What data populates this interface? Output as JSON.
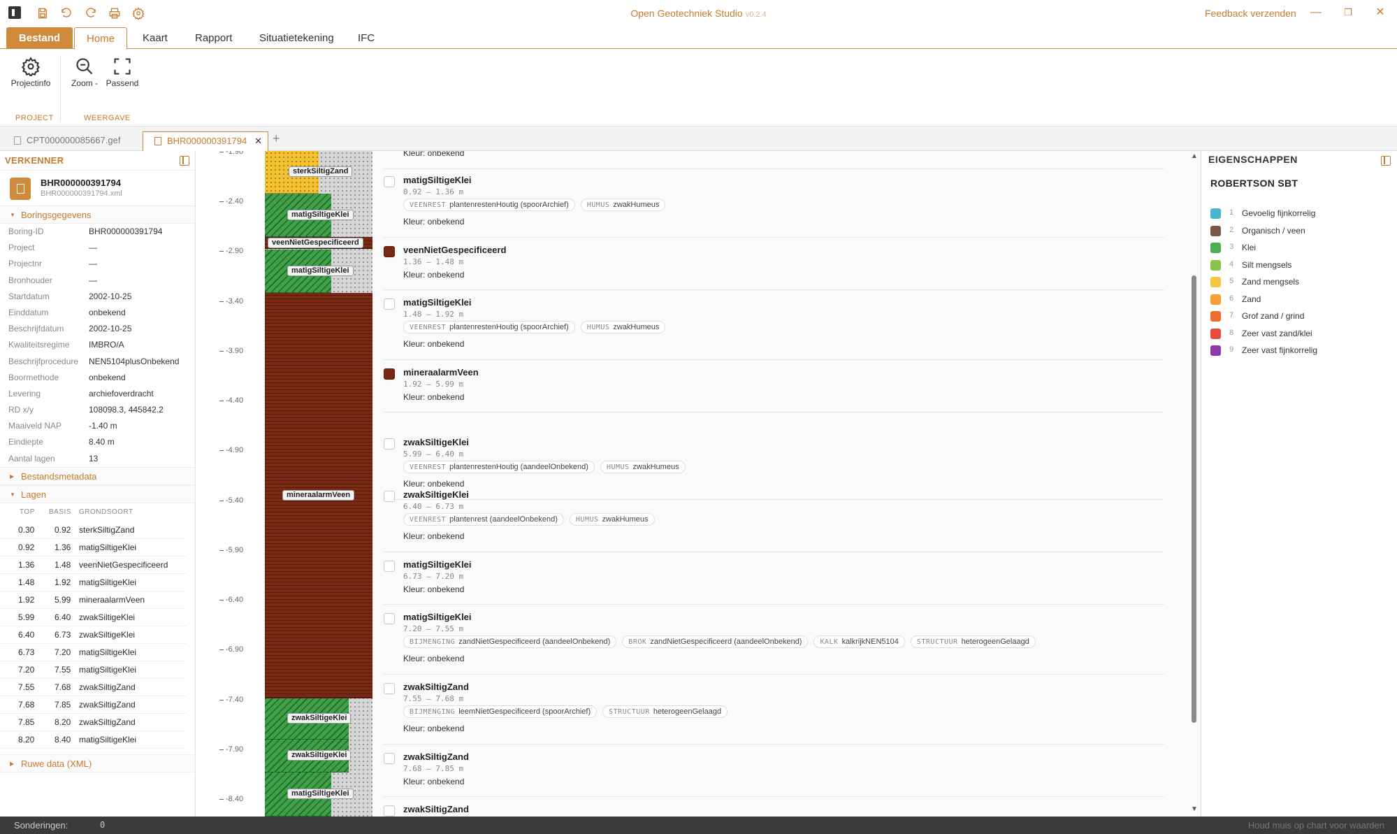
{
  "app": {
    "title": "Open Geotechniek Studio",
    "version": "v0.2.4",
    "feedback": "Feedback verzenden"
  },
  "icons": {
    "quick_access": [
      "save-icon",
      "undo-icon",
      "redo-icon",
      "print-icon",
      "settings-icon"
    ]
  },
  "ribbon": {
    "tabs": [
      "Bestand",
      "Home",
      "Kaart",
      "Rapport",
      "Situatietekening",
      "IFC"
    ],
    "active_tab": "Home",
    "buttons": {
      "projectinfo": "Projectinfo",
      "zoom": "Zoom -",
      "passend": "Passend"
    },
    "groups": {
      "project": "PROJECT",
      "weergave": "WEERGAVE"
    }
  },
  "doc_tabs": [
    {
      "label": "CPT000000085667.gef"
    },
    {
      "label": "BHR000000391794",
      "active": true
    }
  ],
  "explorer": {
    "title": "VERKENNER",
    "file": {
      "name": "BHR000000391794",
      "file": "BHR000000391794.xml"
    },
    "sections": {
      "boring": "Boringsgegevens",
      "meta": "Bestandsmetadata",
      "layers": "Lagen",
      "raw": "Ruwe data (XML)"
    },
    "props": [
      {
        "k": "Boring-ID",
        "v": "BHR000000391794"
      },
      {
        "k": "Project",
        "v": "—"
      },
      {
        "k": "Projectnr",
        "v": "—"
      },
      {
        "k": "Bronhouder",
        "v": "—"
      },
      {
        "k": "Startdatum",
        "v": "2002-10-25"
      },
      {
        "k": "Einddatum",
        "v": "onbekend"
      },
      {
        "k": "Beschrijfdatum",
        "v": "2002-10-25"
      },
      {
        "k": "Kwaliteitsregime",
        "v": "IMBRO/A"
      },
      {
        "k": "Beschrijfprocedure",
        "v": "NEN5104plusOnbekend"
      },
      {
        "k": "Boormethode",
        "v": "onbekend"
      },
      {
        "k": "Levering",
        "v": "archiefoverdracht"
      },
      {
        "k": "RD x/y",
        "v": "108098.3, 445842.2"
      },
      {
        "k": "Maaiveld NAP",
        "v": "-1.40 m"
      },
      {
        "k": "Eindiepte",
        "v": "8.40 m"
      },
      {
        "k": "Aantal lagen",
        "v": "13"
      }
    ],
    "layer_headers": {
      "top": "TOP",
      "basis": "BASIS",
      "soil": "GRONDSOORT"
    },
    "layers": [
      {
        "top": "0.30",
        "basis": "0.92",
        "soil": "sterkSiltigZand"
      },
      {
        "top": "0.92",
        "basis": "1.36",
        "soil": "matigSiltigeKlei"
      },
      {
        "top": "1.36",
        "basis": "1.48",
        "soil": "veenNietGespecificeerd"
      },
      {
        "top": "1.48",
        "basis": "1.92",
        "soil": "matigSiltigeKlei"
      },
      {
        "top": "1.92",
        "basis": "5.99",
        "soil": "mineraalarmVeen"
      },
      {
        "top": "5.99",
        "basis": "6.40",
        "soil": "zwakSiltigeKlei"
      },
      {
        "top": "6.40",
        "basis": "6.73",
        "soil": "zwakSiltigeKlei"
      },
      {
        "top": "6.73",
        "basis": "7.20",
        "soil": "matigSiltigeKlei"
      },
      {
        "top": "7.20",
        "basis": "7.55",
        "soil": "matigSiltigeKlei"
      },
      {
        "top": "7.55",
        "basis": "7.68",
        "soil": "zwakSiltigZand"
      },
      {
        "top": "7.68",
        "basis": "7.85",
        "soil": "zwakSiltigZand"
      },
      {
        "top": "7.85",
        "basis": "8.20",
        "soil": "zwakSiltigZand"
      },
      {
        "top": "8.20",
        "basis": "8.40",
        "soil": "matigSiltigeKlei"
      }
    ]
  },
  "chart": {
    "y_ticks": [
      "-1.90",
      "-2.40",
      "-2.90",
      "-3.40",
      "-3.90",
      "-4.40",
      "-4.90",
      "-5.40",
      "-5.90",
      "-6.40",
      "-6.90",
      "-7.40",
      "-7.90",
      "-8.40"
    ],
    "bars": [
      {
        "label": "sterkSiltigZand",
        "top_nap": -1.7,
        "bottom_nap": -2.32,
        "color": "#f2c232",
        "type": "zand",
        "width": 0.5
      },
      {
        "label": "matigSiltigeKlei",
        "top_nap": -2.32,
        "bottom_nap": -2.76,
        "color": "#3f9f4a",
        "type": "klei",
        "width": 0.62
      },
      {
        "label": "veenNietGespecificeerd",
        "top_nap": -2.76,
        "bottom_nap": -2.88,
        "color": "#7a2a14",
        "type": "veen",
        "width": 1.0
      },
      {
        "label": "matigSiltigeKlei",
        "top_nap": -2.88,
        "bottom_nap": -3.32,
        "color": "#3f9f4a",
        "type": "klei",
        "width": 0.62
      },
      {
        "label": "mineraalarmVeen",
        "top_nap": -3.32,
        "bottom_nap": -7.39,
        "color": "#7a2a14",
        "type": "veen",
        "width": 1.0
      },
      {
        "label": "zwakSiltigeKlei",
        "top_nap": -7.39,
        "bottom_nap": -7.8,
        "color": "#3f9f4a",
        "type": "klei",
        "width": 0.78
      },
      {
        "label": "zwakSiltigeKlei",
        "top_nap": -7.8,
        "bottom_nap": -8.13,
        "color": "#3f9f4a",
        "type": "klei",
        "width": 0.78
      },
      {
        "label": "matigSiltigeKlei",
        "top_nap": -8.13,
        "bottom_nap": -8.6,
        "color": "#3f9f4a",
        "type": "klei",
        "width": 0.62
      }
    ]
  },
  "list": {
    "first_kleur": "Kleur: onbekend",
    "items": [
      {
        "name": "matigSiltigeKlei",
        "range": "0.92 – 1.36 m",
        "filled": false,
        "color": "#ffffff",
        "tags": [
          {
            "k": "VEENREST",
            "v": "plantenrestenHoutig (spoorArchief)"
          },
          {
            "k": "HUMUS",
            "v": "zwakHumeus"
          }
        ],
        "kleur": "Kleur: onbekend"
      },
      {
        "name": "veenNietGespecificeerd",
        "range": "1.36 – 1.48 m",
        "filled": true,
        "color": "#7a2a14",
        "tags": [],
        "kleur": "Kleur: onbekend"
      },
      {
        "name": "matigSiltigeKlei",
        "range": "1.48 – 1.92 m",
        "filled": false,
        "color": "#ffffff",
        "tags": [
          {
            "k": "VEENREST",
            "v": "plantenrestenHoutig (spoorArchief)"
          },
          {
            "k": "HUMUS",
            "v": "zwakHumeus"
          }
        ],
        "kleur": "Kleur: onbekend"
      },
      {
        "name": "mineraalarmVeen",
        "range": "1.92 – 5.99 m",
        "filled": true,
        "color": "#7a2a14",
        "tags": [],
        "kleur": "Kleur: onbekend"
      },
      {
        "name": "zwakSiltigeKlei",
        "range": "5.99 – 6.40 m",
        "filled": false,
        "color": "#ffffff",
        "tags": [
          {
            "k": "VEENREST",
            "v": "plantenrestenHoutig (aandeelOnbekend)"
          },
          {
            "k": "HUMUS",
            "v": "zwakHumeus"
          }
        ],
        "kleur": "Kleur: onbekend"
      },
      {
        "name": "zwakSiltigeKlei",
        "range": "6.40 – 6.73 m",
        "filled": false,
        "color": "#ffffff",
        "tags": [
          {
            "k": "VEENREST",
            "v": "plantenrest (aandeelOnbekend)"
          },
          {
            "k": "HUMUS",
            "v": "zwakHumeus"
          }
        ],
        "kleur": "Kleur: onbekend"
      },
      {
        "name": "matigSiltigeKlei",
        "range": "6.73 – 7.20 m",
        "filled": false,
        "color": "#ffffff",
        "tags": [],
        "kleur": "Kleur: onbekend"
      },
      {
        "name": "matigSiltigeKlei",
        "range": "7.20 – 7.55 m",
        "filled": false,
        "color": "#ffffff",
        "tags": [
          {
            "k": "BIJMENGING",
            "v": "zandNietGespecificeerd (aandeelOnbekend)"
          },
          {
            "k": "BROK",
            "v": "zandNietGespecificeerd (aandeelOnbekend)"
          },
          {
            "k": "KALK",
            "v": "kalkrijkNEN5104"
          },
          {
            "k": "STRUCTUUR",
            "v": "heterogeenGelaagd"
          }
        ],
        "kleur": "Kleur: onbekend"
      },
      {
        "name": "zwakSiltigZand",
        "range": "7.55 – 7.68 m",
        "filled": false,
        "color": "#ffffff",
        "tags": [
          {
            "k": "BIJMENGING",
            "v": "leemNietGespecificeerd (spoorArchief)"
          },
          {
            "k": "STRUCTUUR",
            "v": "heterogeenGelaagd"
          }
        ],
        "kleur": "Kleur: onbekend"
      },
      {
        "name": "zwakSiltigZand",
        "range": "7.68 – 7.85 m",
        "filled": false,
        "color": "#ffffff",
        "tags": [],
        "kleur": "Kleur: onbekend"
      },
      {
        "name": "zwakSiltigZand",
        "range": "",
        "filled": false,
        "color": "#ffffff",
        "tags": [],
        "kleur": ""
      }
    ]
  },
  "properties": {
    "title": "EIGENSCHAPPEN",
    "subtitle": "ROBERTSON SBT",
    "legend": [
      {
        "n": "1",
        "label": "Gevoelig fijnkorrelig",
        "color": "#4ab3d0"
      },
      {
        "n": "2",
        "label": "Organisch / veen",
        "color": "#7a5548"
      },
      {
        "n": "3",
        "label": "Klei",
        "color": "#4caf50"
      },
      {
        "n": "4",
        "label": "Silt mengsels",
        "color": "#8bc34a"
      },
      {
        "n": "5",
        "label": "Zand mengsels",
        "color": "#f4c842"
      },
      {
        "n": "6",
        "label": "Zand",
        "color": "#f5a033"
      },
      {
        "n": "7",
        "label": "Grof zand / grind",
        "color": "#f26b2e"
      },
      {
        "n": "8",
        "label": "Zeer vast zand/klei",
        "color": "#e74c3c"
      },
      {
        "n": "9",
        "label": "Zeer vast fijnkorrelig",
        "color": "#8e3aa8"
      }
    ]
  },
  "status": {
    "label": "Sonderingen:",
    "count": "0",
    "hint": "Houd muis op chart voor waarden"
  }
}
